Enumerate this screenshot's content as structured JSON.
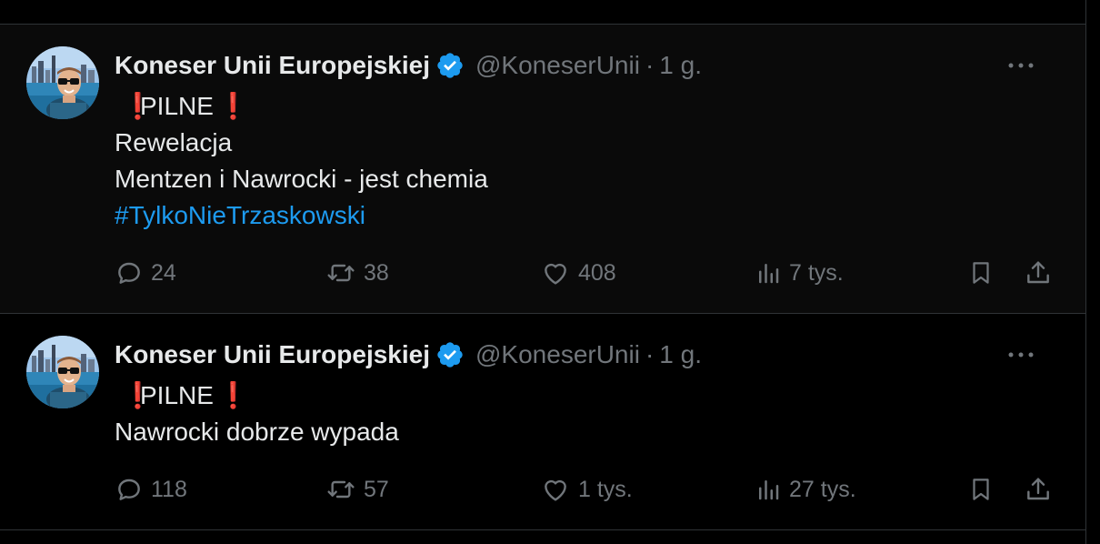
{
  "colors": {
    "background": "#000000",
    "text": "#e7e9ea",
    "muted": "#71767b",
    "link": "#1d9bf0",
    "verified": "#1d9bf0",
    "emoji_red": "#dd2e44",
    "divider": "#2f3336"
  },
  "tweets": [
    {
      "author": {
        "name": "Koneser Unii Europejskiej",
        "handle": "@KoneserUnii",
        "verified_icon": "verified-badge-icon",
        "avatar_icon": "avatar-photo"
      },
      "separator": "·",
      "time": "1 g.",
      "lines": {
        "pilne": "PILNE",
        "pilne_emoji": "❗",
        "line2": "Rewelacja",
        "line3": "Mentzen i Nawrocki - jest chemia",
        "hashtag": "#TylkoNieTrzaskowski"
      },
      "stats": {
        "replies": "24",
        "reposts": "38",
        "likes": "408",
        "views": "7 tys."
      }
    },
    {
      "author": {
        "name": "Koneser Unii Europejskiej",
        "handle": "@KoneserUnii",
        "verified_icon": "verified-badge-icon",
        "avatar_icon": "avatar-photo"
      },
      "separator": "·",
      "time": "1 g.",
      "lines": {
        "pilne": "PILNE",
        "pilne_emoji": "❗",
        "line2": "Nawrocki dobrze wypada"
      },
      "stats": {
        "replies": "118",
        "reposts": "57",
        "likes": "1 tys.",
        "views": "27 tys."
      }
    }
  ]
}
